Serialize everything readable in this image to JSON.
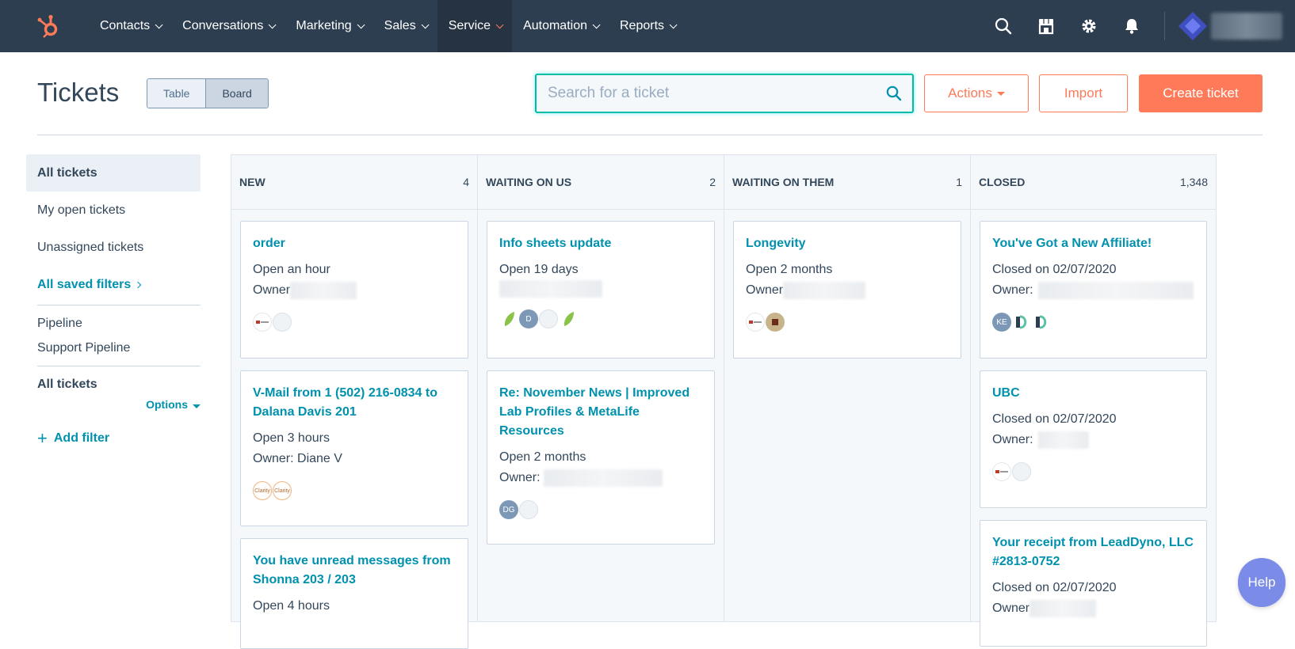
{
  "nav": {
    "items": [
      {
        "label": "Contacts"
      },
      {
        "label": "Conversations"
      },
      {
        "label": "Marketing"
      },
      {
        "label": "Sales"
      },
      {
        "label": "Service"
      },
      {
        "label": "Automation"
      },
      {
        "label": "Reports"
      }
    ],
    "active": "Service",
    "icons": [
      "search-icon",
      "marketplace-icon",
      "settings-icon",
      "notifications-icon"
    ]
  },
  "header": {
    "title": "Tickets",
    "view_toggle": {
      "table": "Table",
      "board": "Board",
      "active": "Board"
    },
    "search_placeholder": "Search for a ticket",
    "actions_label": "Actions",
    "import_label": "Import",
    "create_label": "Create ticket"
  },
  "sidebar": {
    "views": [
      {
        "label": "All tickets",
        "active": true
      },
      {
        "label": "My open tickets"
      },
      {
        "label": "Unassigned tickets"
      }
    ],
    "saved_filters": "All saved filters",
    "pipeline_heading": "Pipeline",
    "pipeline_value": "Support Pipeline",
    "filter_heading": "All tickets",
    "options_label": "Options",
    "add_filter": "Add filter"
  },
  "board": {
    "columns": [
      {
        "name": "NEW",
        "count": "4",
        "cards": [
          {
            "title": "order",
            "status": "Open an hour",
            "owner": "Owner"
          },
          {
            "title": "V-Mail from 1 (502) 216-0834 to Dalana Davis 201",
            "status": "Open 3 hours",
            "owner": "Owner: Diane V"
          },
          {
            "title": "You have unread messages from Shonna 203 / 203",
            "status": "Open 4 hours",
            "owner": ""
          }
        ]
      },
      {
        "name": "WAITING ON US",
        "count": "2",
        "cards": [
          {
            "title": "Info sheets update",
            "status": "Open 19 days",
            "owner": ""
          },
          {
            "title": "Re: November News | Improved Lab Profiles & MetaLife Resources",
            "status": "Open 2 months",
            "owner": "Owner:"
          }
        ]
      },
      {
        "name": "WAITING ON THEM",
        "count": "1",
        "cards": [
          {
            "title": "Longevity",
            "status": "Open 2 months",
            "owner": "Owner"
          }
        ]
      },
      {
        "name": "CLOSED",
        "count": "1,348",
        "cards": [
          {
            "title": "You've Got a New Affiliate!",
            "status": "Closed on 02/07/2020",
            "owner": "Owner:"
          },
          {
            "title": "UBC",
            "status": "Closed on 02/07/2020",
            "owner": "Owner:"
          },
          {
            "title": "Your receipt from LeadDyno, LLC #2813-0752",
            "status": "Closed on 02/07/2020",
            "owner": "Owner"
          }
        ]
      }
    ],
    "avatar_initials": {
      "d": "D",
      "dg": "DG",
      "ke": "KE",
      "clarity": "Clarity"
    }
  },
  "help_label": "Help",
  "colors": {
    "nav_bg": "#2d3e50",
    "accent": "#ff7a59",
    "link": "#0091ae",
    "focus": "#00bda5"
  }
}
